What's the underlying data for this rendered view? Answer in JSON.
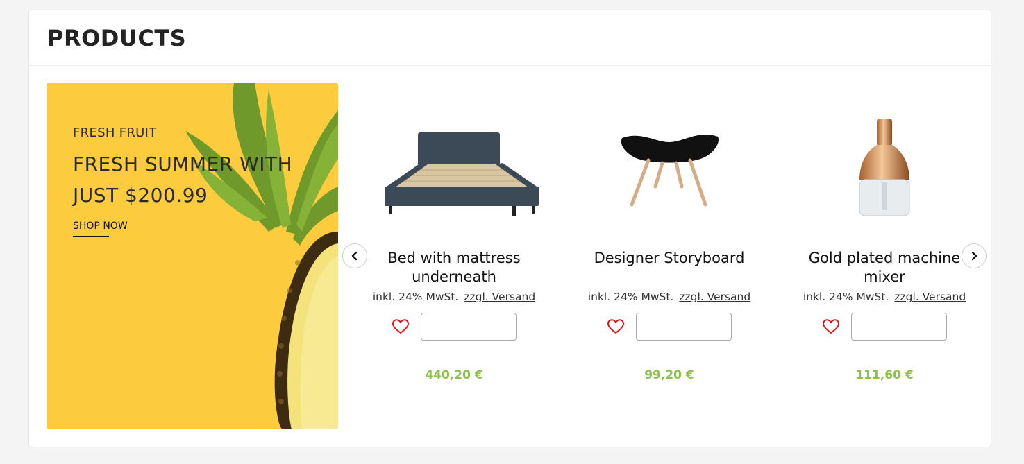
{
  "section": {
    "title": "PRODUCTS"
  },
  "banner": {
    "kicker": "FRESH FRUIT",
    "headline_line1": "FRESH SUMMER WITH",
    "headline_line2": "JUST $200.99",
    "cta": "SHOP NOW",
    "background_color": "#fdcc3e"
  },
  "carousel": {
    "prev_icon": "chevron-left-icon",
    "next_icon": "chevron-right-icon",
    "products": [
      {
        "name": "Bed with mattress underneath",
        "tax_text": "inkl. 24% MwSt.",
        "shipping_link": "zzgl. Versand",
        "qty_value": "",
        "price": "440,20 €",
        "image": "bed-image"
      },
      {
        "name": "Designer Storyboard",
        "tax_text": "inkl. 24% MwSt.",
        "shipping_link": "zzgl. Versand",
        "qty_value": "",
        "price": "99,20 €",
        "image": "footstool-image"
      },
      {
        "name": "Gold plated machine mixer",
        "tax_text": "inkl. 24% MwSt.",
        "shipping_link": "zzgl. Versand",
        "qty_value": "",
        "price": "111,60 €",
        "image": "bottle-image"
      }
    ]
  },
  "colors": {
    "price": "#8bc34a",
    "heart": "#e0161b"
  }
}
